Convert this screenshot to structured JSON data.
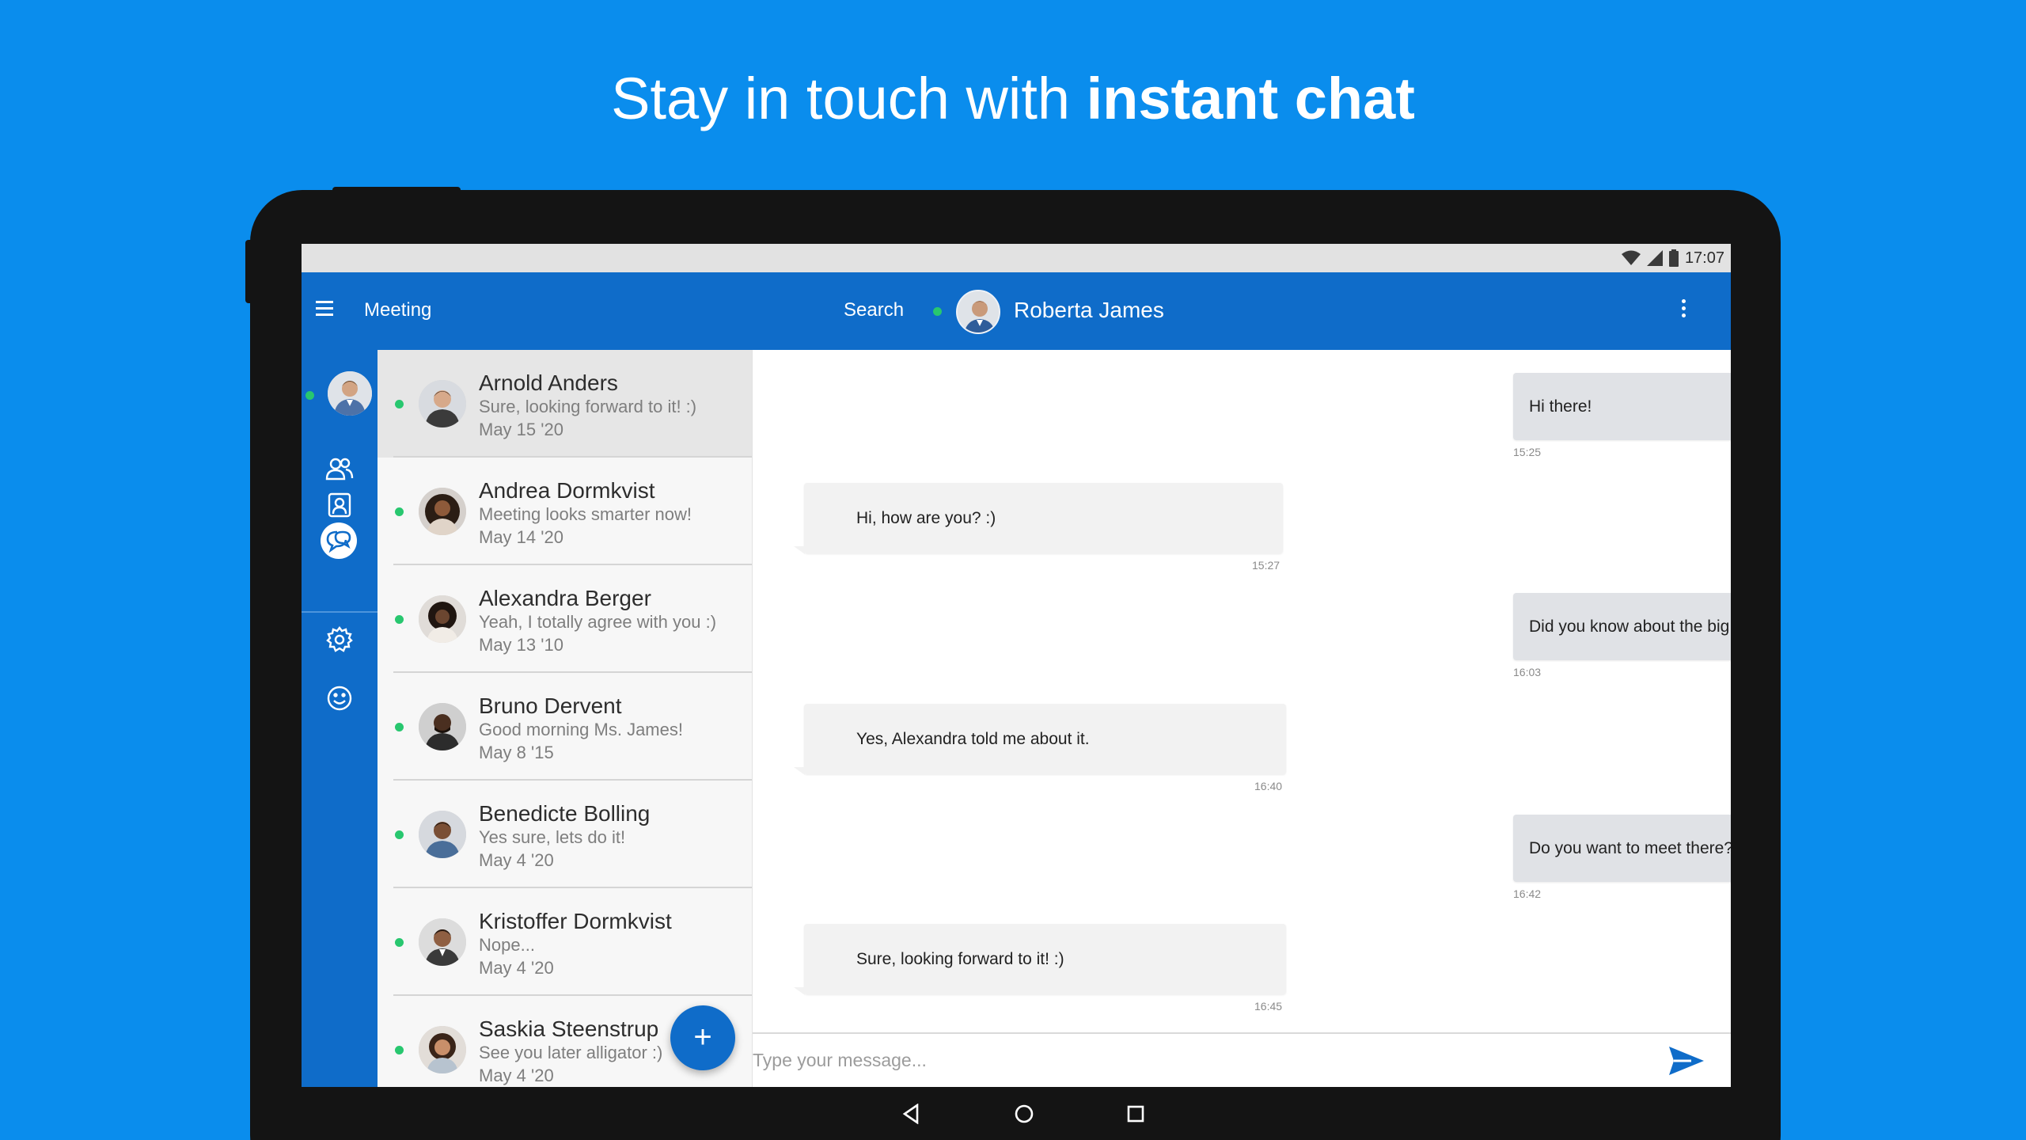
{
  "headline": {
    "light": "Stay in touch with ",
    "bold": "instant chat"
  },
  "statusbar": {
    "time": "17:07"
  },
  "appbar": {
    "title": "Meeting",
    "search_label": "Search",
    "contact_name": "Roberta James"
  },
  "rail": {
    "icons": [
      "people-icon",
      "contacts-icon",
      "chat-icon",
      "settings-icon",
      "smiley-icon"
    ],
    "active": "chat-icon"
  },
  "conversations": [
    {
      "name": "Arnold Anders",
      "preview": "Sure, looking forward to it! :)",
      "date": "May 15 '20"
    },
    {
      "name": "Andrea Dormkvist",
      "preview": "Meeting looks smarter now!",
      "date": "May 14 '20"
    },
    {
      "name": "Alexandra Berger",
      "preview": "Yeah, I totally agree with you :)",
      "date": "May 13 '10"
    },
    {
      "name": "Bruno Dervent",
      "preview": "Good morning Ms. James!",
      "date": "May 8 '15"
    },
    {
      "name": "Benedicte Bolling",
      "preview": "Yes sure, lets do it!",
      "date": "May 4 '20"
    },
    {
      "name": "Kristoffer Dormkvist",
      "preview": "Nope...",
      "date": "May 4 '20"
    },
    {
      "name": "Saskia Steenstrup",
      "preview": "See you later alligator :)",
      "date": "May 4 '20"
    }
  ],
  "messages": [
    {
      "direction": "out",
      "text": "Hi there!",
      "time": "15:25"
    },
    {
      "direction": "in",
      "text": "Hi, how are you? :)",
      "time": "15:27"
    },
    {
      "direction": "out",
      "text": "Did you know about the big event in the gallery?",
      "time": "16:03"
    },
    {
      "direction": "in",
      "text": "Yes, Alexandra told me about it.",
      "time": "16:40"
    },
    {
      "direction": "out",
      "text": "Do you want to meet there?",
      "time": "16:42"
    },
    {
      "direction": "in",
      "text": "Sure, looking forward to it! :)",
      "time": "16:45"
    }
  ],
  "composer": {
    "placeholder": "Type your message..."
  },
  "fab": {
    "label": "+"
  },
  "colors": {
    "background": "#0a8ded",
    "primary": "#0f6cc9",
    "online": "#28c76f"
  }
}
